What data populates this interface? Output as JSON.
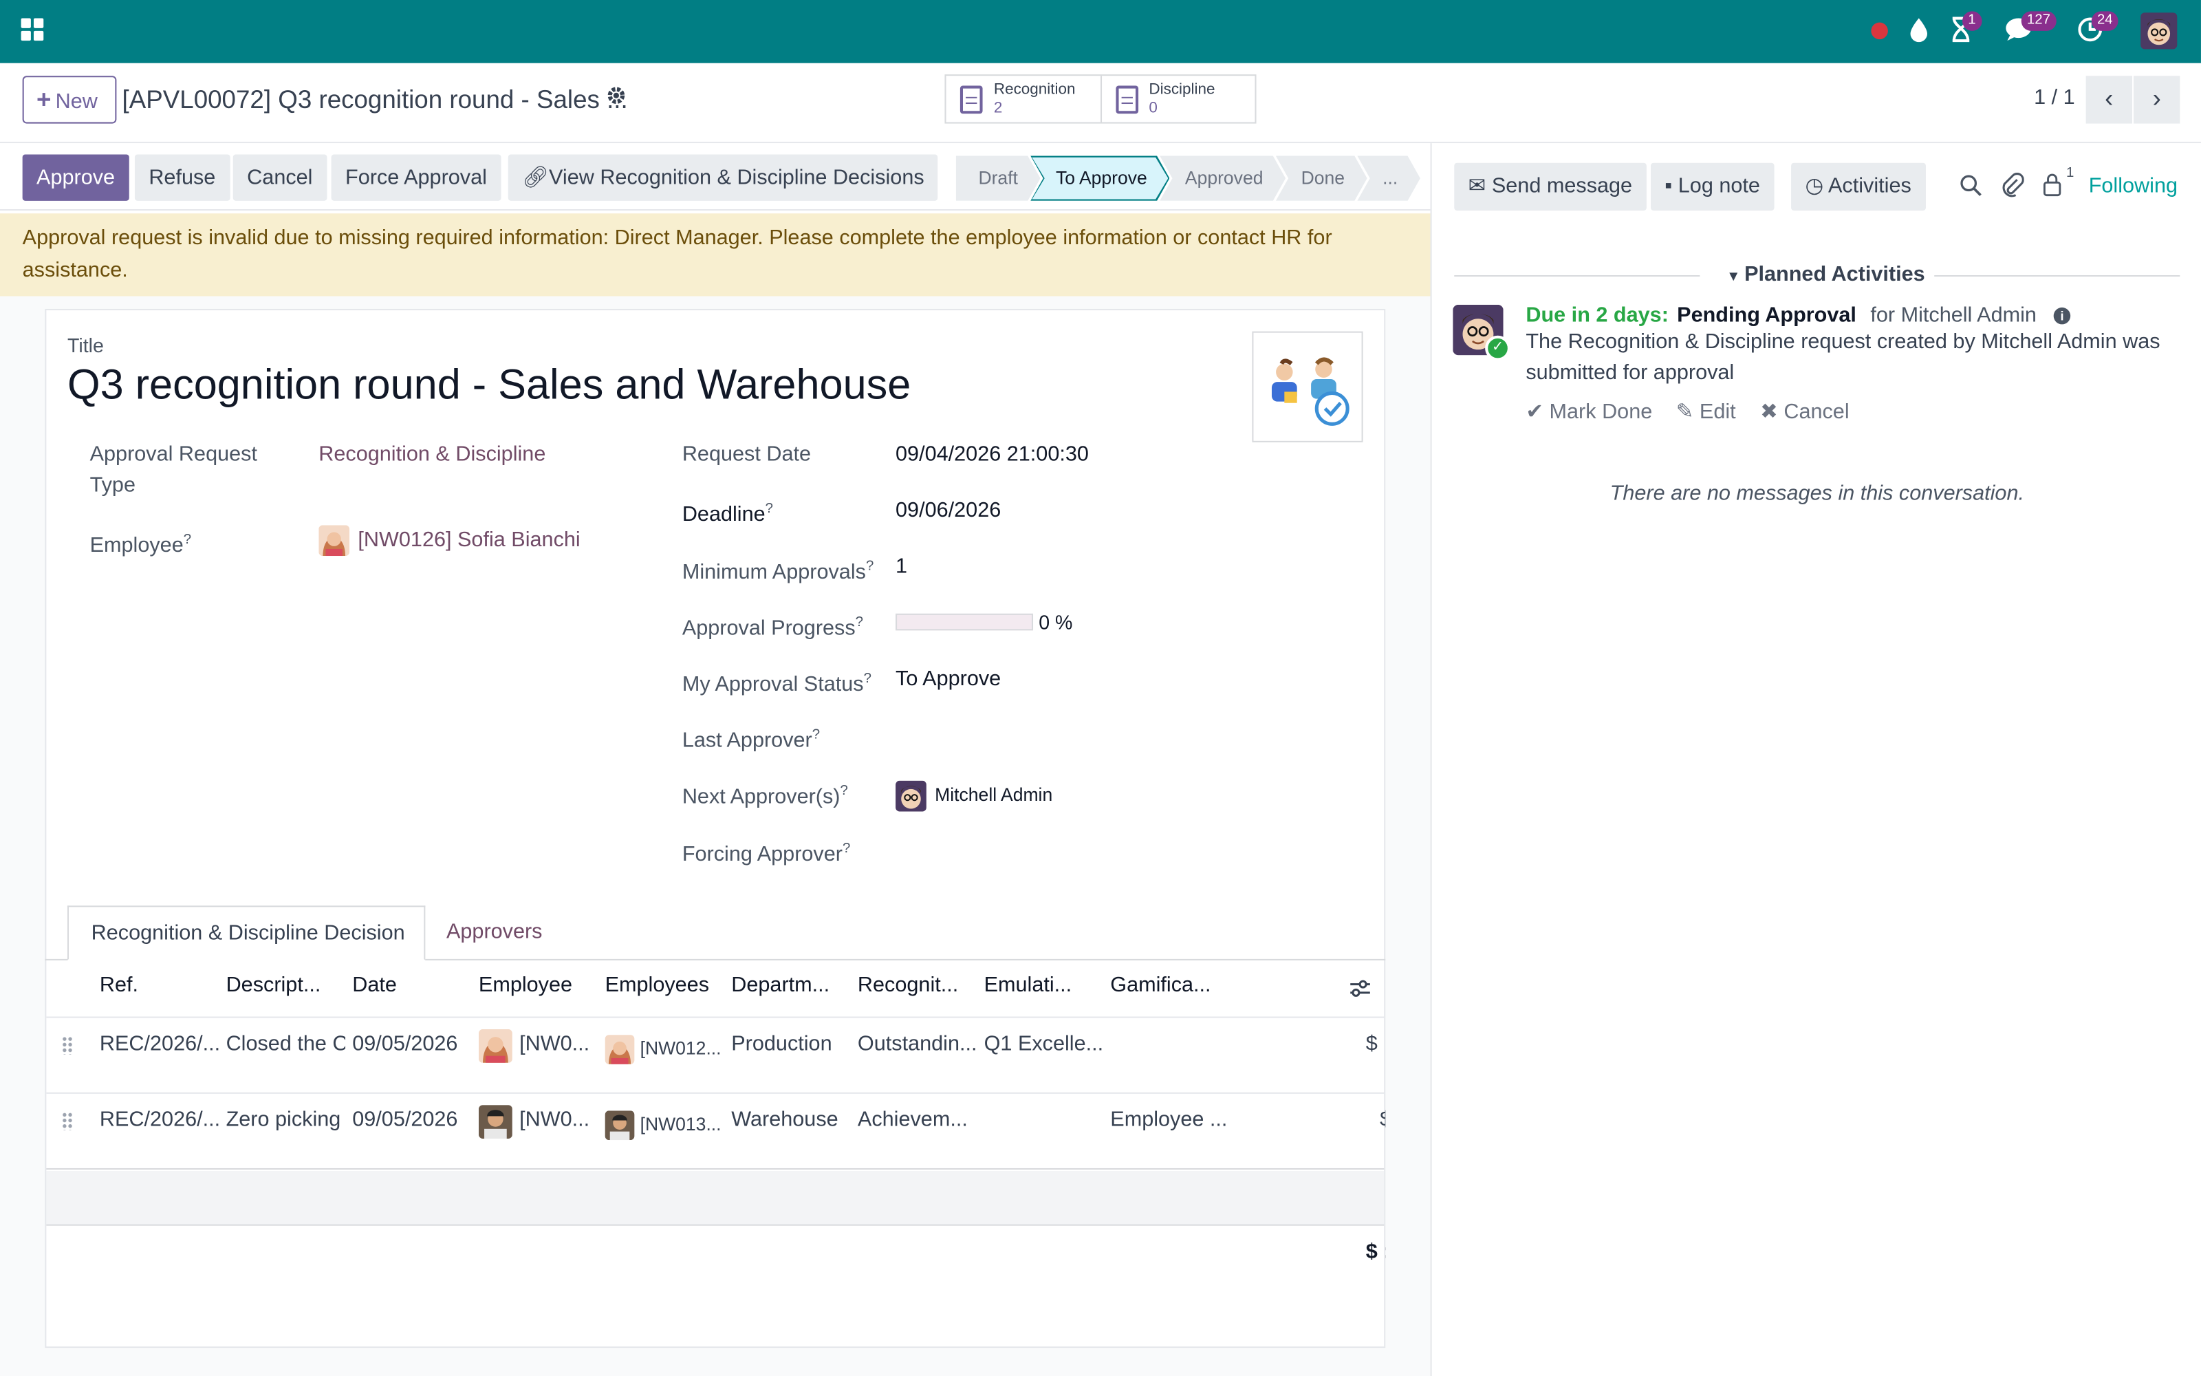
{
  "topbar": {
    "activity_badge": "1",
    "messages_badge": "127",
    "clock_badge": "24"
  },
  "control": {
    "new_label": "New",
    "record_title": "[APVL00072] Q3 recognition round - Sales ...",
    "smart_buttons": [
      {
        "label": "Recognition",
        "count": "2"
      },
      {
        "label": "Discipline",
        "count": "0"
      }
    ],
    "pager": "1 / 1"
  },
  "actions": {
    "approve": "Approve",
    "refuse": "Refuse",
    "cancel": "Cancel",
    "force": "Force Approval",
    "view": "View Recognition & Discipline Decisions"
  },
  "stages": [
    "Draft",
    "To Approve",
    "Approved",
    "Done",
    "..."
  ],
  "alert": "Approval request is invalid due to missing required information: Direct Manager. Please complete the employee information or contact HR for assistance.",
  "form": {
    "title_label": "Title",
    "title": "Q3 recognition round - Sales and Warehouse",
    "approval_type_label_1": "Approval Request",
    "approval_type_label_2": "Type",
    "approval_type": "Recognition & Discipline",
    "employee_label": "Employee",
    "employee": "[NW0126] Sofia Bianchi",
    "request_date_label": "Request Date",
    "request_date": "09/04/2026 21:00:30",
    "deadline_label": "Deadline",
    "deadline": "09/06/2026",
    "min_approvals_label": "Minimum Approvals",
    "min_approvals": "1",
    "progress_label": "Approval Progress",
    "progress_text": "0 %",
    "progress_value": 0,
    "my_status_label": "My Approval Status",
    "my_status": "To Approve",
    "last_approver_label": "Last Approver",
    "next_approver_label": "Next Approver(s)",
    "next_approver": "Mitchell Admin",
    "forcing_approver_label": "Forcing Approver",
    "help_mark": "?"
  },
  "tabs": [
    "Recognition & Discipline Decision",
    "Approvers"
  ],
  "table": {
    "headers": [
      "Ref.",
      "Descript...",
      "Date",
      "Employee",
      "Employees",
      "Departm...",
      "Recognit...",
      "Emulati...",
      "Gamifica..."
    ],
    "rows": [
      {
        "ref": "REC/2026/...",
        "desc": "Closed the C",
        "date": "09/05/2026",
        "employee": "[NW0...",
        "employees": "[NW012...",
        "dept": "Production",
        "recog": "Outstandin...",
        "emul": "Q1 Excelle...",
        "gamif": "",
        "amount": "$"
      },
      {
        "ref": "REC/2026/...",
        "desc": "Zero picking",
        "date": "09/05/2026",
        "employee": "[NW0...",
        "employees": "[NW013...",
        "dept": "Warehouse",
        "recog": "Achievem...",
        "emul": "",
        "gamif": "Employee ...",
        "amount": "$"
      }
    ],
    "total": "$ :"
  },
  "chatter": {
    "send_message": "Send message",
    "log_note": "Log note",
    "activities": "Activities",
    "follower_count": "1",
    "following": "Following",
    "planned_title": "Planned Activities",
    "due": "Due in 2 days:",
    "activity_type": "Pending Approval",
    "for_user": "for Mitchell Admin",
    "description": "The Recognition & Discipline request created by Mitchell Admin was submitted for approval",
    "mark_done": "Mark Done",
    "edit": "Edit",
    "cancel": "Cancel",
    "no_messages": "There are no messages in this conversation."
  },
  "colors": {
    "navbar": "#017e84",
    "primary": "#71639e",
    "link": "#714b67",
    "alert_bg": "#f8efd0",
    "due_green": "#28a745"
  }
}
